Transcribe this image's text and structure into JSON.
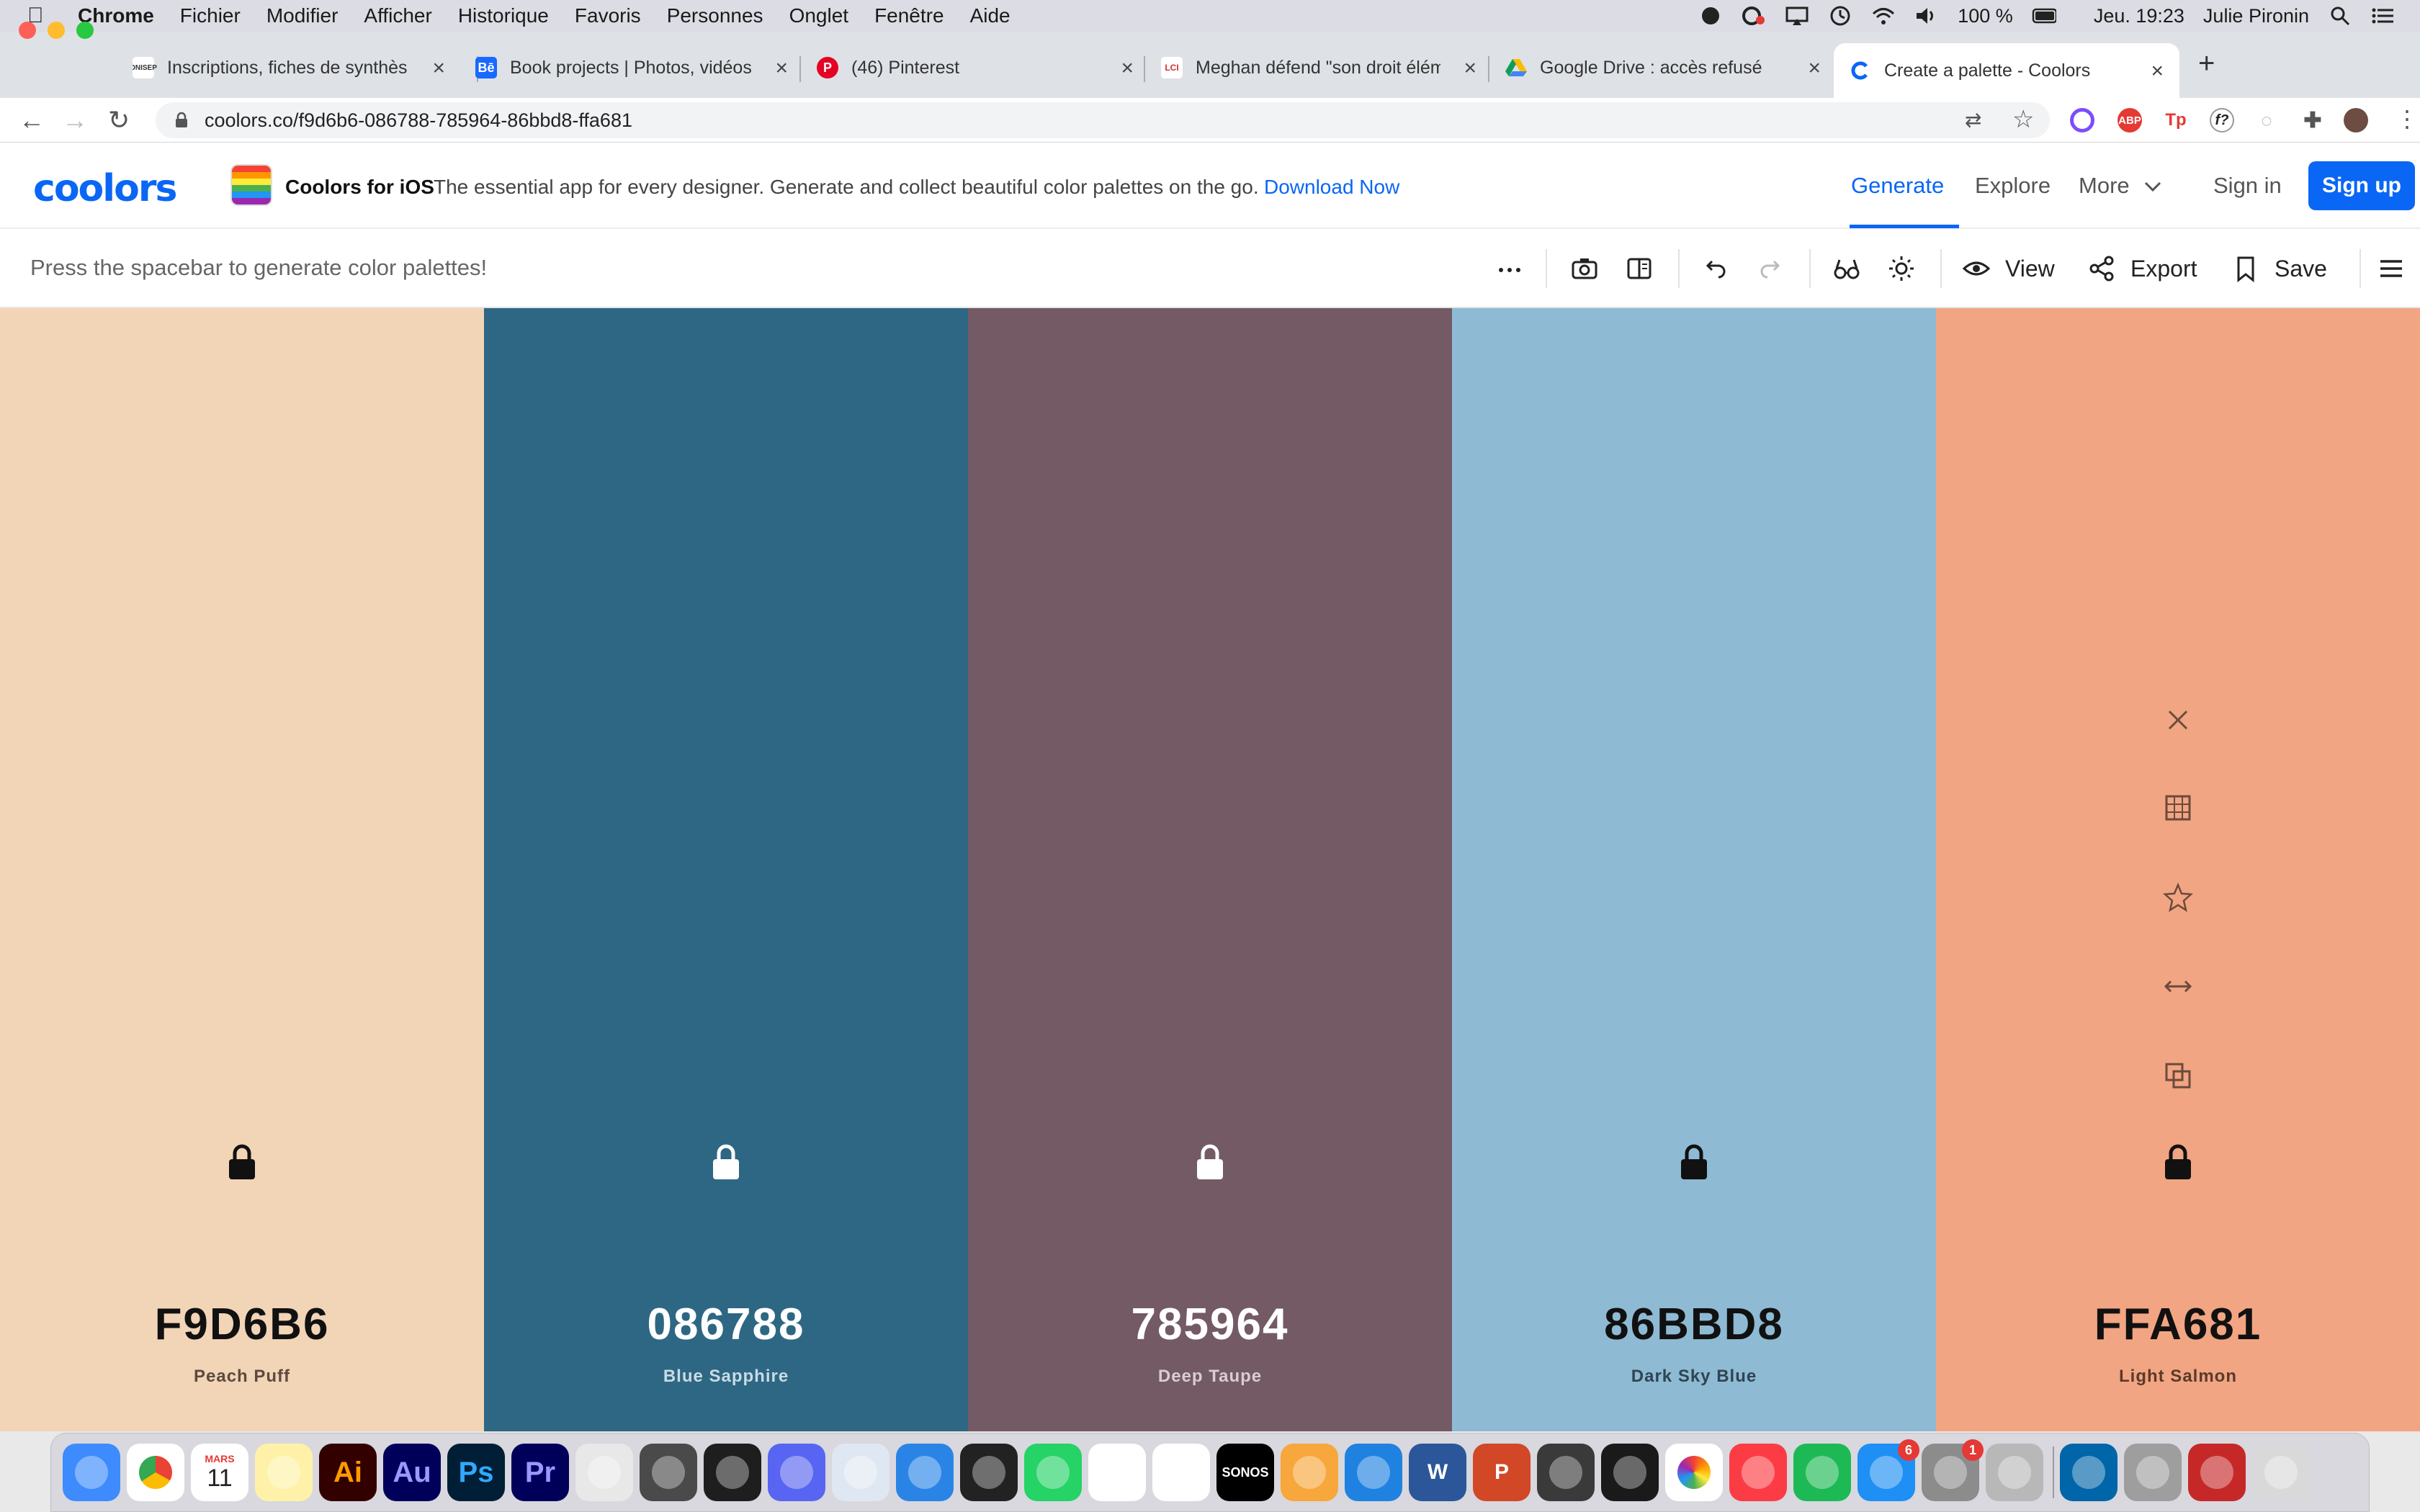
{
  "menubar": {
    "app": "Chrome",
    "items": [
      "Fichier",
      "Modifier",
      "Afficher",
      "Historique",
      "Favoris",
      "Personnes",
      "Onglet",
      "Fenêtre",
      "Aide"
    ],
    "battery": "100 %",
    "datetime": "Jeu. 19:23",
    "user": "Julie Pironin"
  },
  "tabs": [
    {
      "title": "Inscriptions, fiches de synthès",
      "favicon": "ONISEP"
    },
    {
      "title": "Book projects | Photos, vidéos",
      "favicon": "Bē"
    },
    {
      "title": "(46) Pinterest",
      "favicon": "P"
    },
    {
      "title": "Meghan défend \"son droit élém",
      "favicon": "LCI"
    },
    {
      "title": "Google Drive : accès refusé",
      "favicon": "drive"
    },
    {
      "title": "Create a palette - Coolors",
      "favicon": "C"
    }
  ],
  "address": {
    "url": "coolors.co/f9d6b6-086788-785964-86bbd8-ffa681"
  },
  "extensions": [
    "ABP",
    "Tp",
    "f?"
  ],
  "header": {
    "logo": "coolors",
    "ios_title": "Coolors for iOS",
    "ios_text": "The essential app for every designer. Generate and collect beautiful color palettes on the go.",
    "ios_link": "Download Now",
    "nav": {
      "generate": "Generate",
      "explore": "Explore",
      "more": "More",
      "signin": "Sign in",
      "signup": "Sign up"
    }
  },
  "toolbar": {
    "hint": "Press the spacebar to generate color palettes!",
    "view": "View",
    "export": "Export",
    "save": "Save"
  },
  "palette": [
    {
      "hex": "F9D6B6",
      "name": "Peach Puff",
      "bg": "#F2D4B7",
      "fg": "#111111",
      "sub": "#5b4a3e"
    },
    {
      "hex": "086788",
      "name": "Blue Sapphire",
      "bg": "#2D6783",
      "fg": "#ffffff",
      "sub": "#c9dbe4"
    },
    {
      "hex": "785964",
      "name": "Deep Taupe",
      "bg": "#735A65",
      "fg": "#ffffff",
      "sub": "#d9cdd2"
    },
    {
      "hex": "86BBD8",
      "name": "Dark Sky Blue",
      "bg": "#8EBAD4",
      "fg": "#111111",
      "sub": "#2f4552"
    },
    {
      "hex": "FFA681",
      "name": "Light Salmon",
      "bg": "#F2A582",
      "fg": "#111111",
      "sub": "#5b3a2b"
    }
  ],
  "dock": {
    "apps": [
      "finder",
      "chrome",
      "calendar",
      "notes",
      "illustrator",
      "audition",
      "photoshop",
      "premiere",
      "preview",
      "sublime",
      "figma",
      "discord",
      "virtualbox",
      "safari",
      "terminal",
      "whatsapp",
      "messenger",
      "slack",
      "sonos",
      "pages",
      "keynote",
      "word",
      "powerpoint",
      "printer",
      "acrobat",
      "photos",
      "music",
      "spotify",
      "app-store",
      "system-preferences",
      "archive",
      "vscode",
      "photo-browser",
      "photo-booth",
      "trash"
    ],
    "calendar_month": "MARS",
    "calendar_day": "11",
    "labels": {
      "illustrator": "Ai",
      "audition": "Au",
      "photoshop": "Ps",
      "premiere": "Pr",
      "sonos": "SONOS",
      "word": "W",
      "powerpoint": "P"
    },
    "badges": {
      "app-store": "6",
      "system-preferences": "1"
    }
  }
}
